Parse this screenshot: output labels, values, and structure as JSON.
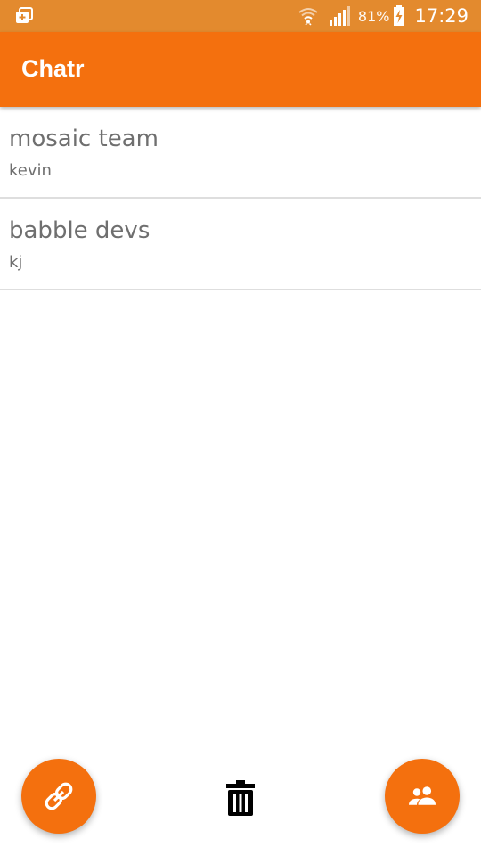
{
  "status_bar": {
    "battery_percent": "81%",
    "time": "17:29",
    "icons": [
      "notification-stack-icon",
      "wifi-icon",
      "cell-signal-icon",
      "battery-charging-icon"
    ]
  },
  "app_bar": {
    "title": "Chatr"
  },
  "chats": [
    {
      "name": "mosaic team",
      "member": "kevin"
    },
    {
      "name": "babble devs",
      "member": "kj"
    }
  ],
  "actions": {
    "left_fab_icon": "link-icon",
    "center_icon": "trash-icon",
    "right_fab_icon": "people-icon"
  },
  "colors": {
    "status_bar": "#e38a2e",
    "primary": "#f4700e",
    "text_secondary": "#6f6f6f",
    "divider": "#dedede"
  }
}
